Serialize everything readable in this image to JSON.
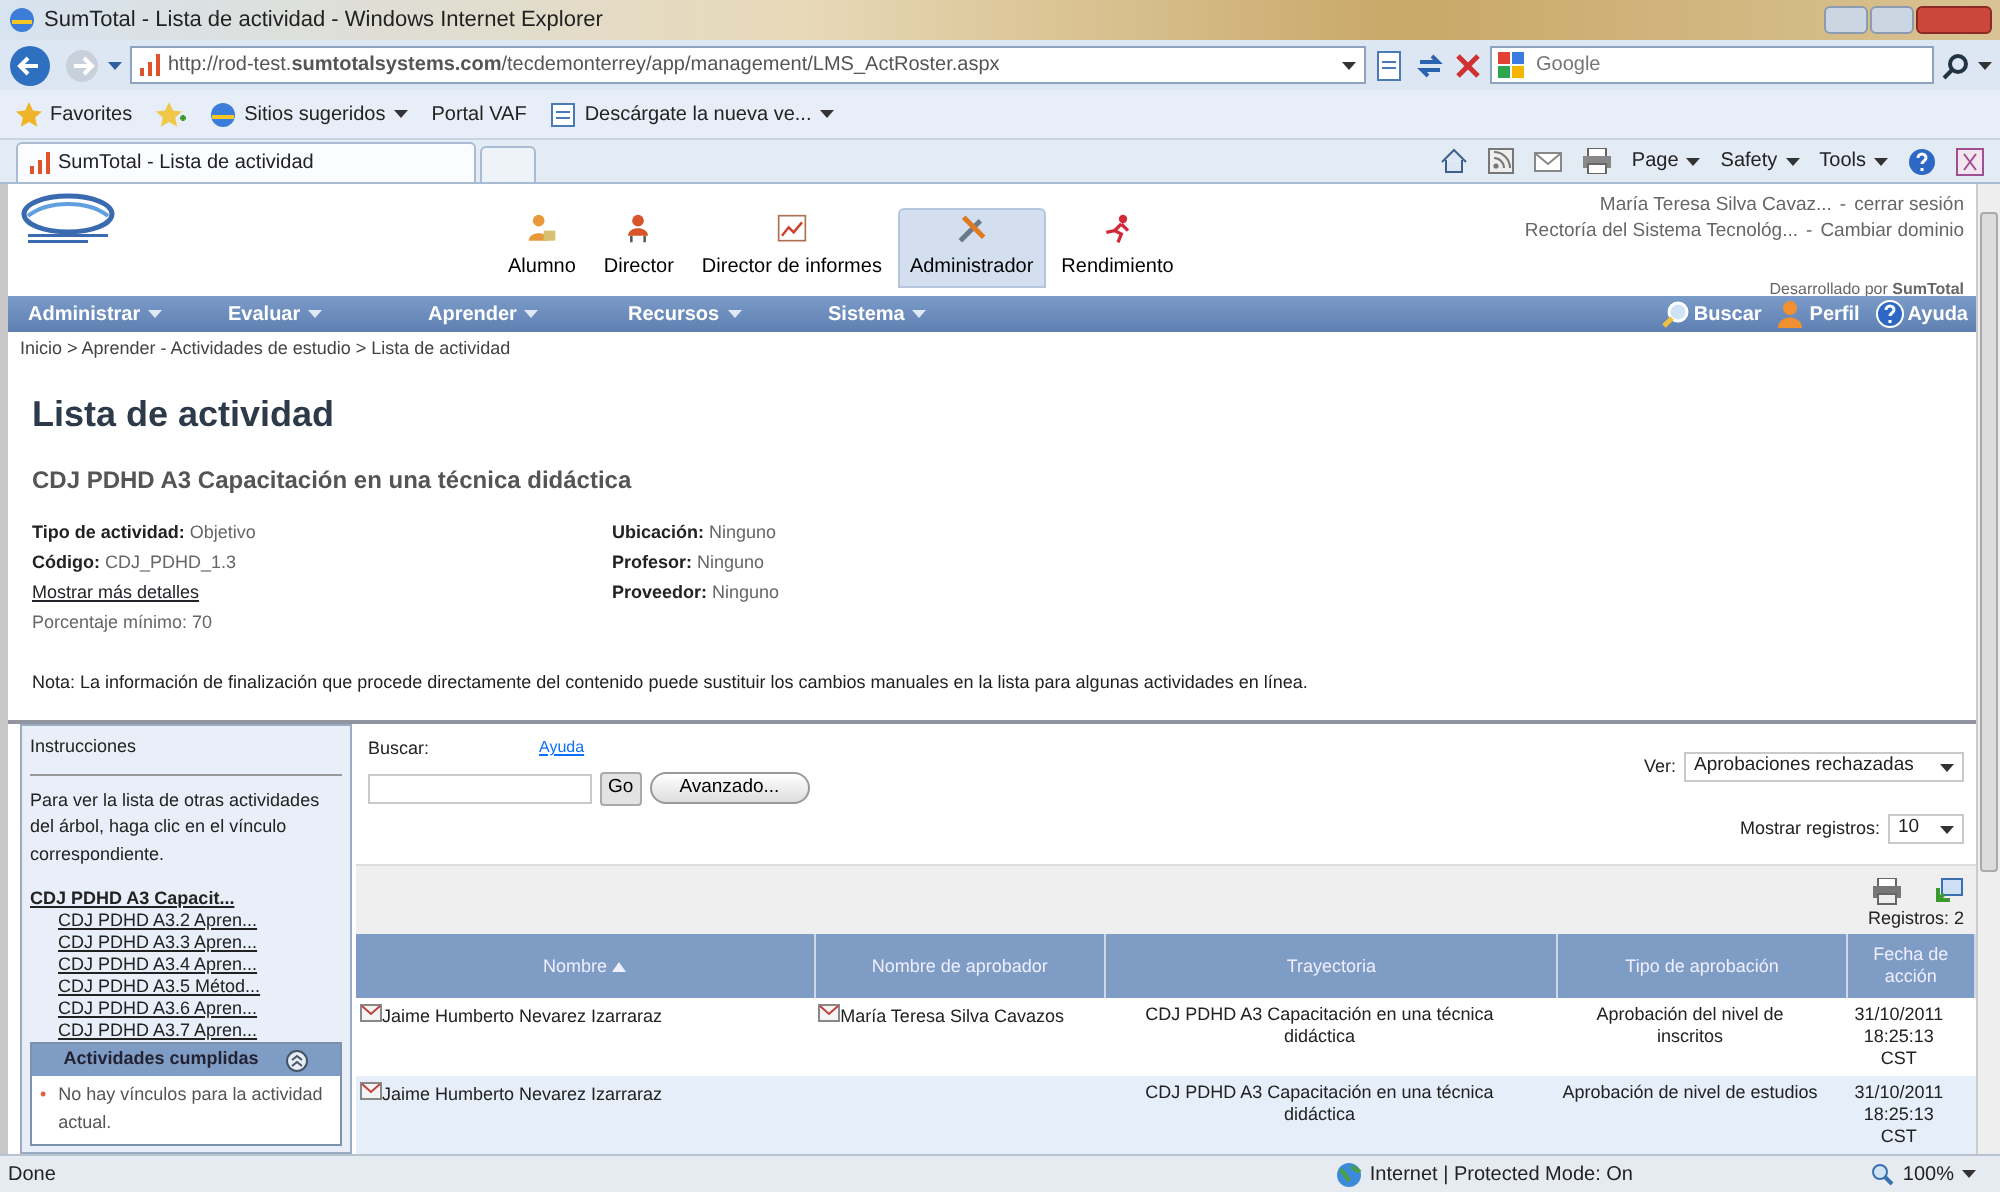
{
  "window": {
    "title": "SumTotal - Lista de actividad - Windows Internet Explorer"
  },
  "address_bar": {
    "url": "http://rod-test.**sumtotalsystems.com**/tecdemonterrey/app/management/LMS_ActRoster.aspx",
    "search_placeholder": "Google"
  },
  "favorites_bar": [
    {
      "label": "Favorites",
      "has_menu": false
    },
    {
      "label": "Sitios sugeridos",
      "has_menu": true
    },
    {
      "label": "Portal VAF",
      "has_menu": false
    },
    {
      "label": "Descárgate la nueva ve...",
      "has_menu": true
    }
  ],
  "tabs": [
    {
      "label": "SumTotal - Lista de actividad",
      "selected": true
    }
  ],
  "command_bar": [
    {
      "label": "Page"
    },
    {
      "label": "Safety"
    },
    {
      "label": "Tools"
    }
  ],
  "header": {
    "nav": [
      {
        "label": "Alumno",
        "selected": false
      },
      {
        "label": "Director",
        "selected": false
      },
      {
        "label": "Director de informes",
        "selected": false
      },
      {
        "label": "Administrador",
        "selected": true
      },
      {
        "label": "Rendimiento",
        "selected": false
      }
    ],
    "user": "María Teresa Silva Cavaz...",
    "logout_separator": "-",
    "logout": "cerrar sesión",
    "org": "Rectoría del Sistema Tecnológ...",
    "domain_separator": "-",
    "change_domain": "Cambiar dominio",
    "powered_by": "Desarrollado por **SumTotal**"
  },
  "menu": [
    {
      "label": "Administrar"
    },
    {
      "label": "Evaluar"
    },
    {
      "label": "Aprender"
    },
    {
      "label": "Recursos"
    },
    {
      "label": "Sistema"
    }
  ],
  "menu_right": [
    {
      "label": "Buscar"
    },
    {
      "label": "Perfil"
    },
    {
      "label": "Ayuda"
    }
  ],
  "breadcrumb": "Inicio > Aprender - Actividades de estudio > Lista de actividad",
  "page": {
    "title": "Lista de actividad",
    "subtitle": "CDJ PDHD A3 Capacitación en una técnica didáctica",
    "details_left": [
      {
        "label": "Tipo de actividad:",
        "value": "Objetivo"
      },
      {
        "label": "Código:",
        "value": "CDJ_PDHD_1.3"
      }
    ],
    "more_link": "Mostrar más detalles",
    "min_percent": "Porcentaje mínimo: 70",
    "details_right": [
      {
        "label": "Ubicación:",
        "value": "Ninguno"
      },
      {
        "label": "Profesor:",
        "value": "Ninguno"
      },
      {
        "label": "Proveedor:",
        "value": "Ninguno"
      }
    ],
    "note": "Nota: La información de finalización que procede directamente del contenido puede sustituir los cambios manuales en la lista para algunas actividades en línea."
  },
  "sidebar": {
    "instructions_title": "Instrucciones",
    "instructions": "Para ver la lista de otras actividades del árbol, haga clic en el vínculo correspondiente.",
    "tree": {
      "label": "CDJ PDHD A3 Capacit...",
      "children": [
        {
          "label": "CDJ PDHD A3.2 Apren..."
        },
        {
          "label": "CDJ PDHD A3.3 Apren..."
        },
        {
          "label": "CDJ PDHD A3.4 Apren..."
        },
        {
          "label": "CDJ PDHD A3.5 Métod..."
        },
        {
          "label": "CDJ PDHD A3.6 Apren..."
        },
        {
          "label": "CDJ PDHD A3.7 Apren..."
        }
      ]
    },
    "completed": {
      "title": "Actividades cumplidas",
      "items": [
        {
          "bullet": "•",
          "text": "No hay vínculos para la actividad actual."
        }
      ]
    }
  },
  "search": {
    "label": "Buscar:",
    "help": "Ayuda",
    "go": "Go",
    "advanced": "Avanzado..."
  },
  "filters": {
    "view_label": "Ver:",
    "view_value": "Aprobaciones rechazadas",
    "records_label": "Mostrar registros:",
    "records_value": "10"
  },
  "table": {
    "count": "Registros: 2",
    "columns": [
      {
        "label": "Nombre",
        "sorted": true
      },
      {
        "label": "Nombre de aprobador",
        "sorted": false
      },
      {
        "label": "Trayectoria",
        "sorted": false
      },
      {
        "label": "Tipo de aprobación",
        "sorted": false
      },
      {
        "label": "Fecha de acción",
        "sorted": false
      }
    ],
    "rows": [
      {
        "name": "Jaime Humberto Nevarez Izarraraz",
        "approver": "María Teresa Silva Cavazos",
        "path": "CDJ PDHD A3 Capacitación en una técnica didáctica",
        "type": "Aprobación del nivel de inscritos",
        "date": "31/10/2011 18:25:13 CST"
      },
      {
        "name": "Jaime Humberto Nevarez Izarraraz",
        "path": "CDJ PDHD A3 Capacitación en una técnica didáctica",
        "type": "Aprobación de nivel de estudios",
        "date": "31/10/2011 18:25:13 CST"
      }
    ]
  },
  "status_bar": {
    "text": "Done",
    "zone": "Internet | Protected Mode: On",
    "zoom": "100%"
  }
}
